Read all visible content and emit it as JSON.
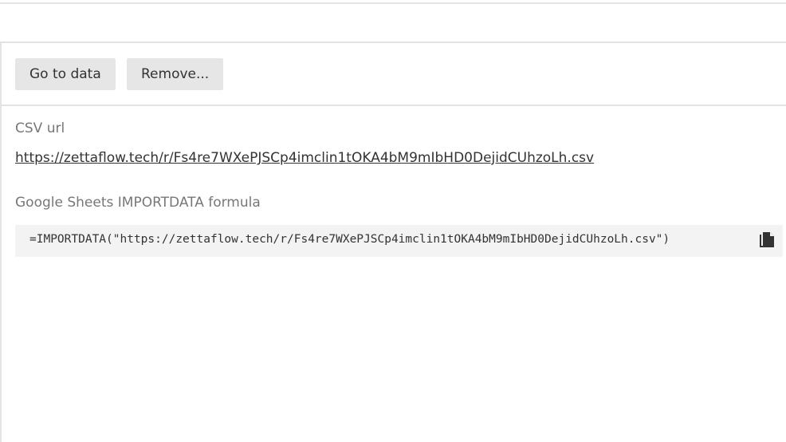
{
  "toolbar": {
    "go_to_data_label": "Go to data",
    "remove_label": "Remove..."
  },
  "csv": {
    "label": "CSV url",
    "url": "https://zettaflow.tech/r/Fs4re7WXePJSCp4imclin1tOKA4bM9mIbHD0DejidCUhzoLh.csv"
  },
  "google_sheets": {
    "label": "Google Sheets IMPORTDATA formula",
    "formula": "=IMPORTDATA(\"https://zettaflow.tech/r/Fs4re7WXePJSCp4imclin1tOKA4bM9mIbHD0DejidCUhzoLh.csv\")",
    "copy_icon": "copy-icon"
  },
  "colors": {
    "button_bg": "#e6e6e6",
    "divider": "#e3e3e3",
    "label_text": "#777777",
    "body_text": "#333333",
    "code_bg": "#f3f3f3"
  }
}
